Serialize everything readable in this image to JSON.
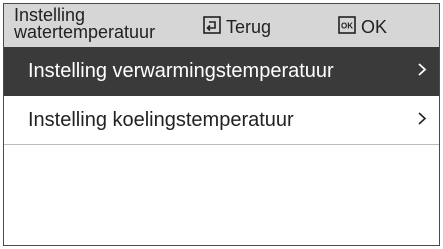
{
  "header": {
    "title_line1": "Instelling",
    "title_line2": "watertemperatuur",
    "back_label": "Terug",
    "ok_icon_text": "OK",
    "ok_label": "OK"
  },
  "menu": {
    "items": [
      {
        "label": "Instelling verwarmingstemperatuur",
        "selected": true
      },
      {
        "label": "Instelling koelingstemperatuur",
        "selected": false
      }
    ]
  },
  "colors": {
    "header_bg": "#d6d6d6",
    "selected_bg": "#3a3a3a",
    "text": "#222222"
  },
  "icons": [
    "back-icon",
    "ok-key-icon",
    "chevron-right-icon"
  ]
}
